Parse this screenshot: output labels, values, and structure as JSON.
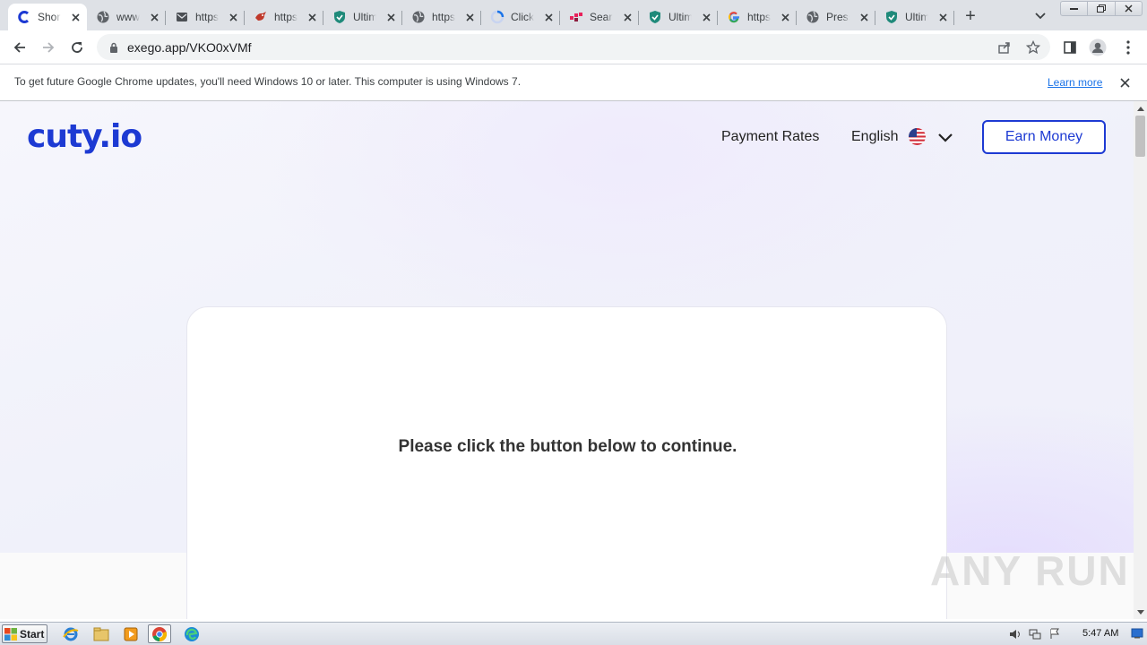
{
  "browser": {
    "tabs": [
      {
        "title": "Short",
        "icon": "cuty-icon",
        "active": true
      },
      {
        "title": "www.",
        "icon": "globe-icon"
      },
      {
        "title": "https",
        "icon": "mail-icon"
      },
      {
        "title": "https",
        "icon": "bird-icon"
      },
      {
        "title": "Ultim",
        "icon": "shield-icon"
      },
      {
        "title": "https",
        "icon": "globe-icon"
      },
      {
        "title": "Click",
        "icon": "loading-icon"
      },
      {
        "title": "Searc",
        "icon": "search-brand-icon"
      },
      {
        "title": "Ultim",
        "icon": "shield-icon"
      },
      {
        "title": "https",
        "icon": "google-icon"
      },
      {
        "title": "Press",
        "icon": "globe-icon"
      },
      {
        "title": "Ultim",
        "icon": "shield-icon"
      }
    ],
    "url": "exego.app/VKO0xVMf"
  },
  "infobar": {
    "message": "To get future Google Chrome updates, you'll need Windows 10 or later. This computer is using Windows 7.",
    "link": "Learn more"
  },
  "page": {
    "logo": "cuty.io",
    "nav_payment": "Payment Rates",
    "language": "English",
    "earn_button": "Earn Money",
    "prompt": "Please click the button below to continue.",
    "brand_color": "#1d3ad3"
  },
  "watermark": "ANY RUN",
  "taskbar": {
    "start_label": "Start",
    "clock": "5:47 AM"
  }
}
